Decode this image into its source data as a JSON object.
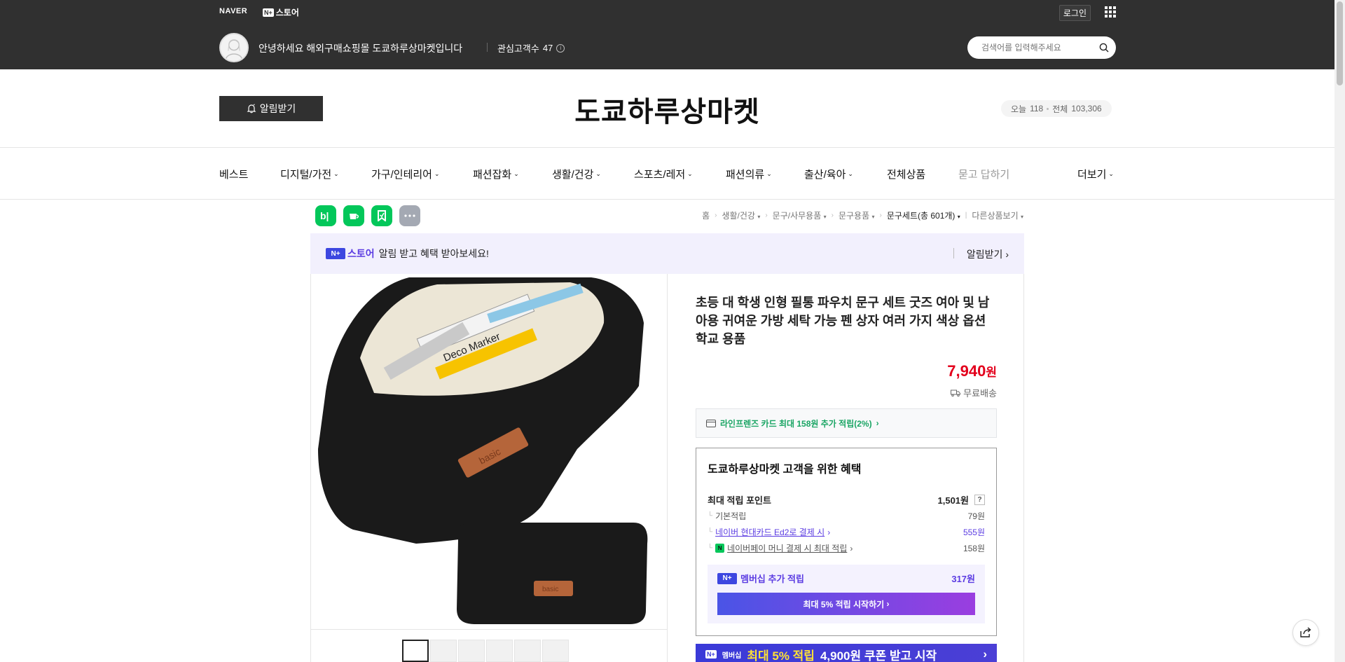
{
  "topbar": {
    "naver": "NAVER",
    "nplus_box": "N+",
    "nplus_text": "스토어",
    "login": "로그인",
    "greeting": "안녕하세요 해외구매쇼핑몰 도쿄하루상마켓입니다",
    "interest_label": "관심고객수",
    "interest_count": "47",
    "search_placeholder": "검색어를 입력해주세요"
  },
  "store": {
    "alarm_label": "알림받기",
    "title": "도쿄하루상마켓",
    "today_label": "오늘",
    "today_count": "118",
    "total_label": "전체",
    "total_count": "103,306"
  },
  "nav": {
    "items": [
      "베스트",
      "디지털/가전",
      "가구/인테리어",
      "패션잡화",
      "생활/건강",
      "스포츠/레저",
      "패션의류",
      "출산/육아",
      "전체상품",
      "묻고 답하기"
    ],
    "more": "더보기"
  },
  "share_icons": [
    {
      "name": "blog-share-icon",
      "glyph": "b|",
      "color": "#03c75a"
    },
    {
      "name": "cafe-share-icon",
      "glyph": "☕",
      "color": "#03c75a"
    },
    {
      "name": "bookmark-share-icon",
      "glyph": "⚑",
      "color": "#03c75a"
    },
    {
      "name": "more-share-icon",
      "glyph": "•••",
      "color": "#a4a9b3"
    }
  ],
  "breadcrumb": {
    "home": "홈",
    "c1": "생활/건강",
    "c2": "문구/사무용품",
    "c3": "문구용품",
    "c4": "문구세트(총 601개)",
    "other": "다른상품보기"
  },
  "banner": {
    "nplus_box": "N+",
    "nstore": "스토어",
    "text": "알림 받고 혜택 받아보세요!",
    "alarm": "알림받기"
  },
  "product": {
    "title": "초등 대 학생 인형 필통 파우치 문구 세트 굿즈 여아 및 남아용 귀여운 가방 세탁 가능 펜 상자 여러 가지 색상 옵션 학교 용품",
    "price": "7,940",
    "price_unit": "원",
    "shipping": "무료배송",
    "card_benefit": "라인프렌즈 카드 최대 158원 추가 적립(2%)",
    "image_text_marker": "Deco Marker",
    "image_text_badge": "basic"
  },
  "benefits": {
    "title": "도쿄하루상마켓 고객을 위한 혜택",
    "max_point_label": "최대 적립 포인트",
    "max_point_value": "1,501원",
    "q": "?",
    "basic_label": "기본적립",
    "basic_value": "79원",
    "hyundai_label": "네이버 현대카드 Ed2로 결제 시",
    "hyundai_value": "555원",
    "npay_label": "네이버페이 머니 결제 시 최대 적립",
    "npay_value": "158원",
    "npay_icon": "N",
    "membership_label": "멤버십 추가 적립",
    "membership_value": "317원",
    "membership_button": "최대 5% 적립 시작하기"
  },
  "coupon": {
    "badge": "N+",
    "badge2": "멤버십",
    "text_highlight": "최대 5% 적립",
    "text": "4,900원 쿠폰 받고 시작"
  },
  "colors": {
    "topbar_bg": "#303030",
    "price_red": "#e3001c",
    "naver_green": "#03c75a",
    "membership_violet": "#5b3ce2"
  }
}
